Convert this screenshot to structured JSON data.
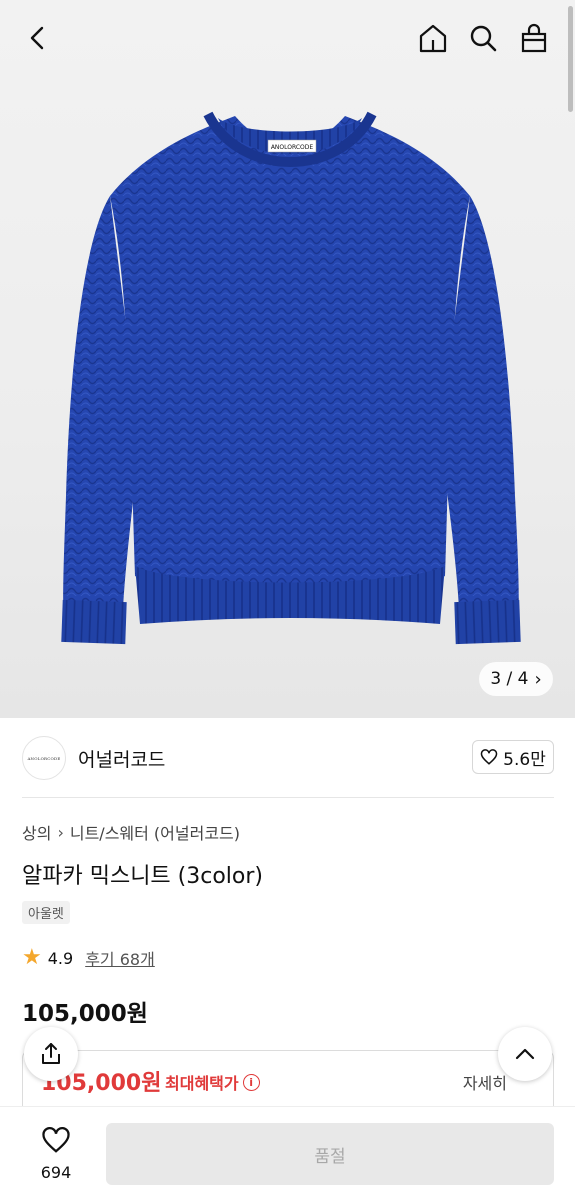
{
  "header": {
    "back_icon": "chevron-left-icon",
    "home_icon": "home-icon",
    "search_icon": "search-icon",
    "cart_icon": "shopping-bag-icon"
  },
  "gallery": {
    "label_text": "ANOLORCODE",
    "sweater_color": "#2546b0",
    "current": "3",
    "total": "4",
    "pager_text": "3 / 4"
  },
  "brand": {
    "logo_text": "ANOLORCODE",
    "name": "어널러코드",
    "likes": "5.6만"
  },
  "breadcrumb": {
    "level1": "상의",
    "level2": "니트/스웨터 (어널러코드)"
  },
  "product": {
    "title": "알파카 믹스니트 (3color)",
    "tag": "아울렛",
    "rating": "4.9",
    "review_label": "후기 68개",
    "price": "105,000원"
  },
  "benefit": {
    "price": "105,000원",
    "label": "최대혜택가",
    "info_icon_text": "i",
    "detail": "자세히"
  },
  "bottom": {
    "wish_count": "694",
    "buy_button": "품절"
  },
  "colors": {
    "accent_red": "#e03a3a",
    "star": "#f4a72d",
    "disabled_button": "#e8e8e8"
  }
}
